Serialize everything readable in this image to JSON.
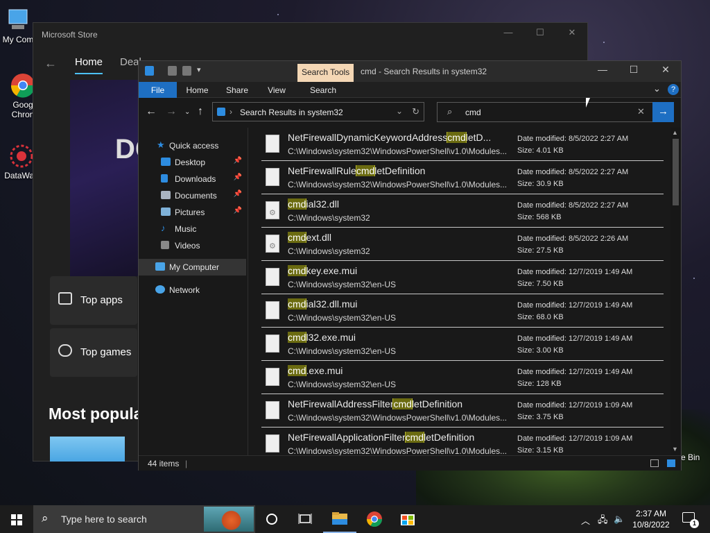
{
  "desktop": {
    "icons": [
      {
        "label": "My Com"
      },
      {
        "label": "Goog Chron"
      },
      {
        "label": "DataWag"
      }
    ],
    "recycle_label": "e Bin"
  },
  "store": {
    "title": "Microsoft Store",
    "tabs": [
      "Home",
      "Deal"
    ],
    "hero_text": "DC",
    "cards": [
      "Top apps",
      "Top games"
    ],
    "section_heading": "Most popula"
  },
  "explorer": {
    "search_tools_label": "Search Tools",
    "title": "cmd - Search Results in system32",
    "ribbon_tabs": [
      "File",
      "Home",
      "Share",
      "View",
      "Search"
    ],
    "address": "Search Results in system32",
    "search_value": "cmd",
    "nav": [
      {
        "label": "Quick access",
        "icon": "star-icon",
        "pinned": false
      },
      {
        "label": "Desktop",
        "icon": "desktop-folder-icon",
        "pinned": true
      },
      {
        "label": "Downloads",
        "icon": "downloads-folder-icon",
        "pinned": true
      },
      {
        "label": "Documents",
        "icon": "documents-folder-icon",
        "pinned": true
      },
      {
        "label": "Pictures",
        "icon": "pictures-folder-icon",
        "pinned": true
      },
      {
        "label": "Music",
        "icon": "music-folder-icon",
        "pinned": false
      },
      {
        "label": "Videos",
        "icon": "videos-folder-icon",
        "pinned": false
      },
      {
        "label": "My Computer",
        "icon": "computer-icon",
        "pinned": false
      },
      {
        "label": "Network",
        "icon": "network-icon",
        "pinned": false
      }
    ],
    "files": [
      {
        "pre": "NetFirewallDynamicKeywordAddress",
        "hl": "cmd",
        "post": "letD...",
        "path": "C:\\Windows\\system32\\WindowsPowerShell\\v1.0\\Modules...",
        "date": "Date modified: 8/5/2022 2:27 AM",
        "size": "Size: 4.01 KB",
        "gear": false
      },
      {
        "pre": "NetFirewallRule",
        "hl": "cmd",
        "post": "letDefinition",
        "path": "C:\\Windows\\system32\\WindowsPowerShell\\v1.0\\Modules...",
        "date": "Date modified: 8/5/2022 2:27 AM",
        "size": "Size: 30.9 KB",
        "gear": false
      },
      {
        "pre": "",
        "hl": "cmd",
        "post": "ial32.dll",
        "path": "C:\\Windows\\system32",
        "date": "Date modified: 8/5/2022 2:27 AM",
        "size": "Size: 568 KB",
        "gear": true
      },
      {
        "pre": "",
        "hl": "cmd",
        "post": "ext.dll",
        "path": "C:\\Windows\\system32",
        "date": "Date modified: 8/5/2022 2:26 AM",
        "size": "Size: 27.5 KB",
        "gear": true
      },
      {
        "pre": "",
        "hl": "cmd",
        "post": "key.exe.mui",
        "path": "C:\\Windows\\system32\\en-US",
        "date": "Date modified: 12/7/2019 1:49 AM",
        "size": "Size: 7.50 KB",
        "gear": false
      },
      {
        "pre": "",
        "hl": "cmd",
        "post": "ial32.dll.mui",
        "path": "C:\\Windows\\system32\\en-US",
        "date": "Date modified: 12/7/2019 1:49 AM",
        "size": "Size: 68.0 KB",
        "gear": false
      },
      {
        "pre": "",
        "hl": "cmd",
        "post": "l32.exe.mui",
        "path": "C:\\Windows\\system32\\en-US",
        "date": "Date modified: 12/7/2019 1:49 AM",
        "size": "Size: 3.00 KB",
        "gear": false
      },
      {
        "pre": "",
        "hl": "cmd",
        "post": ".exe.mui",
        "path": "C:\\Windows\\system32\\en-US",
        "date": "Date modified: 12/7/2019 1:49 AM",
        "size": "Size: 128 KB",
        "gear": false
      },
      {
        "pre": "NetFirewallAddressFilter",
        "hl": "cmd",
        "post": "letDefinition",
        "path": "C:\\Windows\\system32\\WindowsPowerShell\\v1.0\\Modules...",
        "date": "Date modified: 12/7/2019 1:09 AM",
        "size": "Size: 3.75 KB",
        "gear": false
      },
      {
        "pre": "NetFirewallApplicationFilter",
        "hl": "cmd",
        "post": "letDefinition",
        "path": "C:\\Windows\\system32\\WindowsPowerShell\\v1.0\\Modules...",
        "date": "Date modified: 12/7/2019 1:09 AM",
        "size": "Size: 3.15 KB",
        "gear": false
      }
    ],
    "status": "44 items"
  },
  "taskbar": {
    "search_placeholder": "Type here to search",
    "time": "2:37 AM",
    "date": "10/8/2022",
    "notification_count": "1"
  },
  "colors": {
    "accent": "#1e6fc3",
    "highlight": "#6b6b10",
    "search_tools": "#f4d7b5"
  }
}
